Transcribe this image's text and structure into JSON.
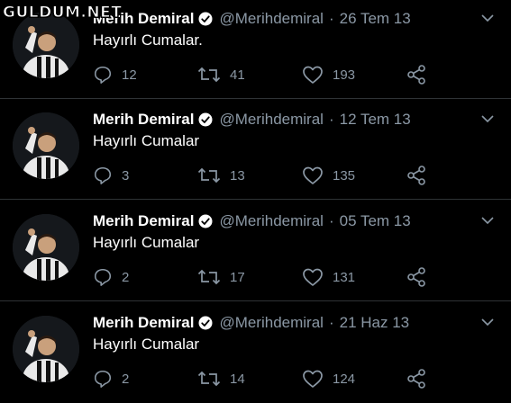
{
  "watermark": "GULDUM.NET",
  "colors": {
    "background": "#000000",
    "text": "#ffffff",
    "muted": "#8b98a5",
    "divider": "#2f3336",
    "verified": "#ffffff"
  },
  "icons": [
    "verified-badge-icon",
    "chevron-down-icon",
    "reply-icon",
    "retweet-icon",
    "like-icon",
    "share-icon"
  ],
  "tweets": [
    {
      "name": "Merih Demiral",
      "handle": "@Merihdemiral",
      "separator": "·",
      "date": "26 Tem 13",
      "text": "Hayırlı Cumalar.",
      "replies": "12",
      "retweets": "41",
      "likes": "193"
    },
    {
      "name": "Merih Demiral",
      "handle": "@Merihdemiral",
      "separator": "·",
      "date": "12 Tem 13",
      "text": "Hayırlı Cumalar",
      "replies": "3",
      "retweets": "13",
      "likes": "135"
    },
    {
      "name": "Merih Demiral",
      "handle": "@Merihdemiral",
      "separator": "·",
      "date": "05 Tem 13",
      "text": "Hayırlı Cumalar",
      "replies": "2",
      "retweets": "17",
      "likes": "131"
    },
    {
      "name": "Merih Demiral",
      "handle": "@Merihdemiral",
      "separator": "·",
      "date": "21 Haz 13",
      "text": "Hayırlı Cumalar",
      "replies": "2",
      "retweets": "14",
      "likes": "124"
    }
  ]
}
